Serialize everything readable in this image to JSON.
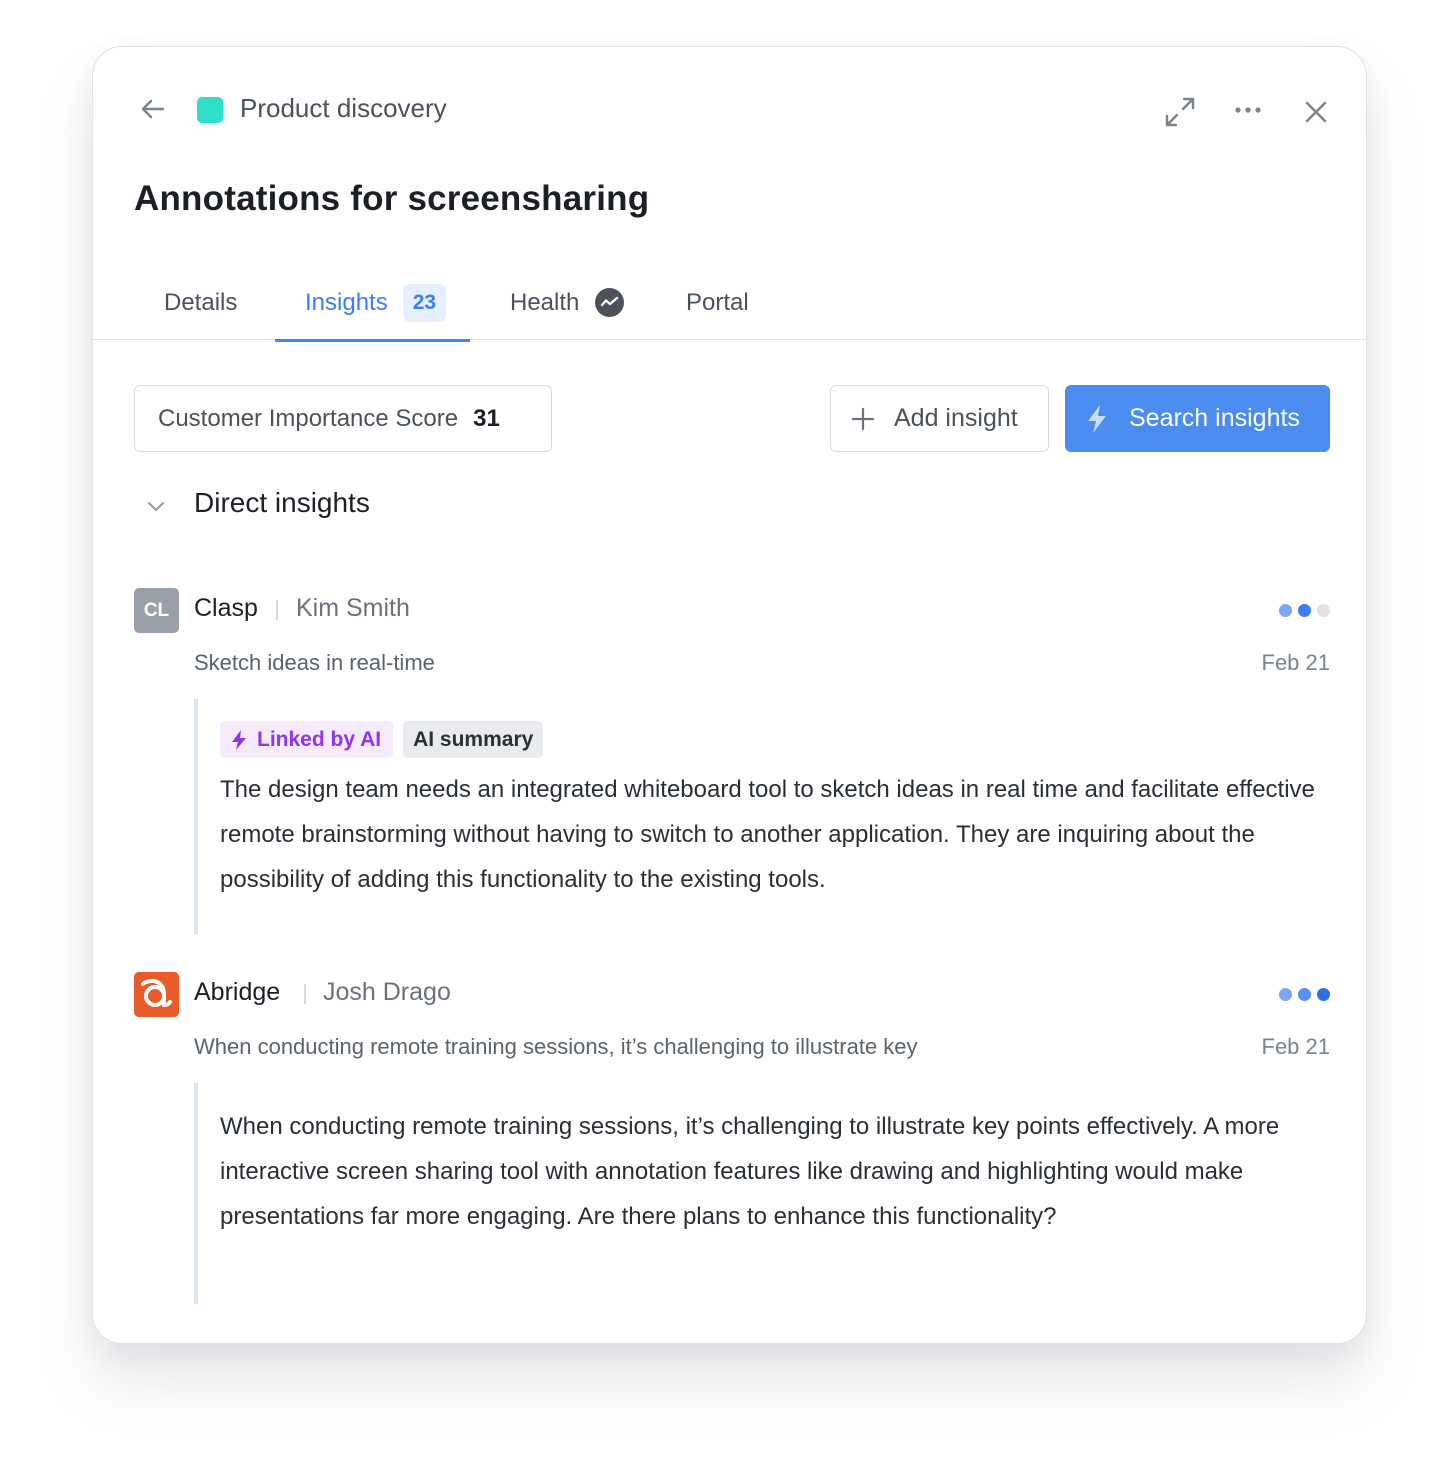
{
  "header": {
    "project_name": "Product discovery",
    "project_color": "#2ee0c8",
    "title": "Annotations for screensharing"
  },
  "tabs": [
    {
      "label": "Details"
    },
    {
      "label": "Insights",
      "badge": "23"
    },
    {
      "label": "Health"
    },
    {
      "label": "Portal"
    }
  ],
  "controls": {
    "score_label": "Customer Importance Score",
    "score_value": "31",
    "add_label": "Add insight",
    "search_label": "Search insights",
    "accent_color": "#4a8cf0"
  },
  "section": {
    "title": "Direct insights"
  },
  "insights": [
    {
      "company": "Clasp",
      "company_initials": "CL",
      "person": "Kim Smith",
      "subtitle": "Sketch ideas in real-time",
      "date": "Feb 21",
      "importance_level": 2,
      "tags": [
        "Linked by AI",
        "AI summary"
      ],
      "text": "The design team needs an integrated whiteboard tool to sketch ideas in real time and facilitate effective remote brainstorming without having to switch to another application. They are inquiring about the possibility of adding this functionality to the existing tools."
    },
    {
      "company": "Abridge",
      "person": "Josh Drago",
      "subtitle": "When conducting remote training sessions, it’s challenging to illustrate key",
      "date": "Feb 21",
      "importance_level": 3,
      "logo_color": "#ea5b2b",
      "text": "When conducting remote training sessions, it’s challenging to illustrate key points effectively. A more interactive screen sharing tool with annotation features like drawing and highlighting would make presentations far more engaging. Are there plans to enhance this functionality?"
    }
  ]
}
